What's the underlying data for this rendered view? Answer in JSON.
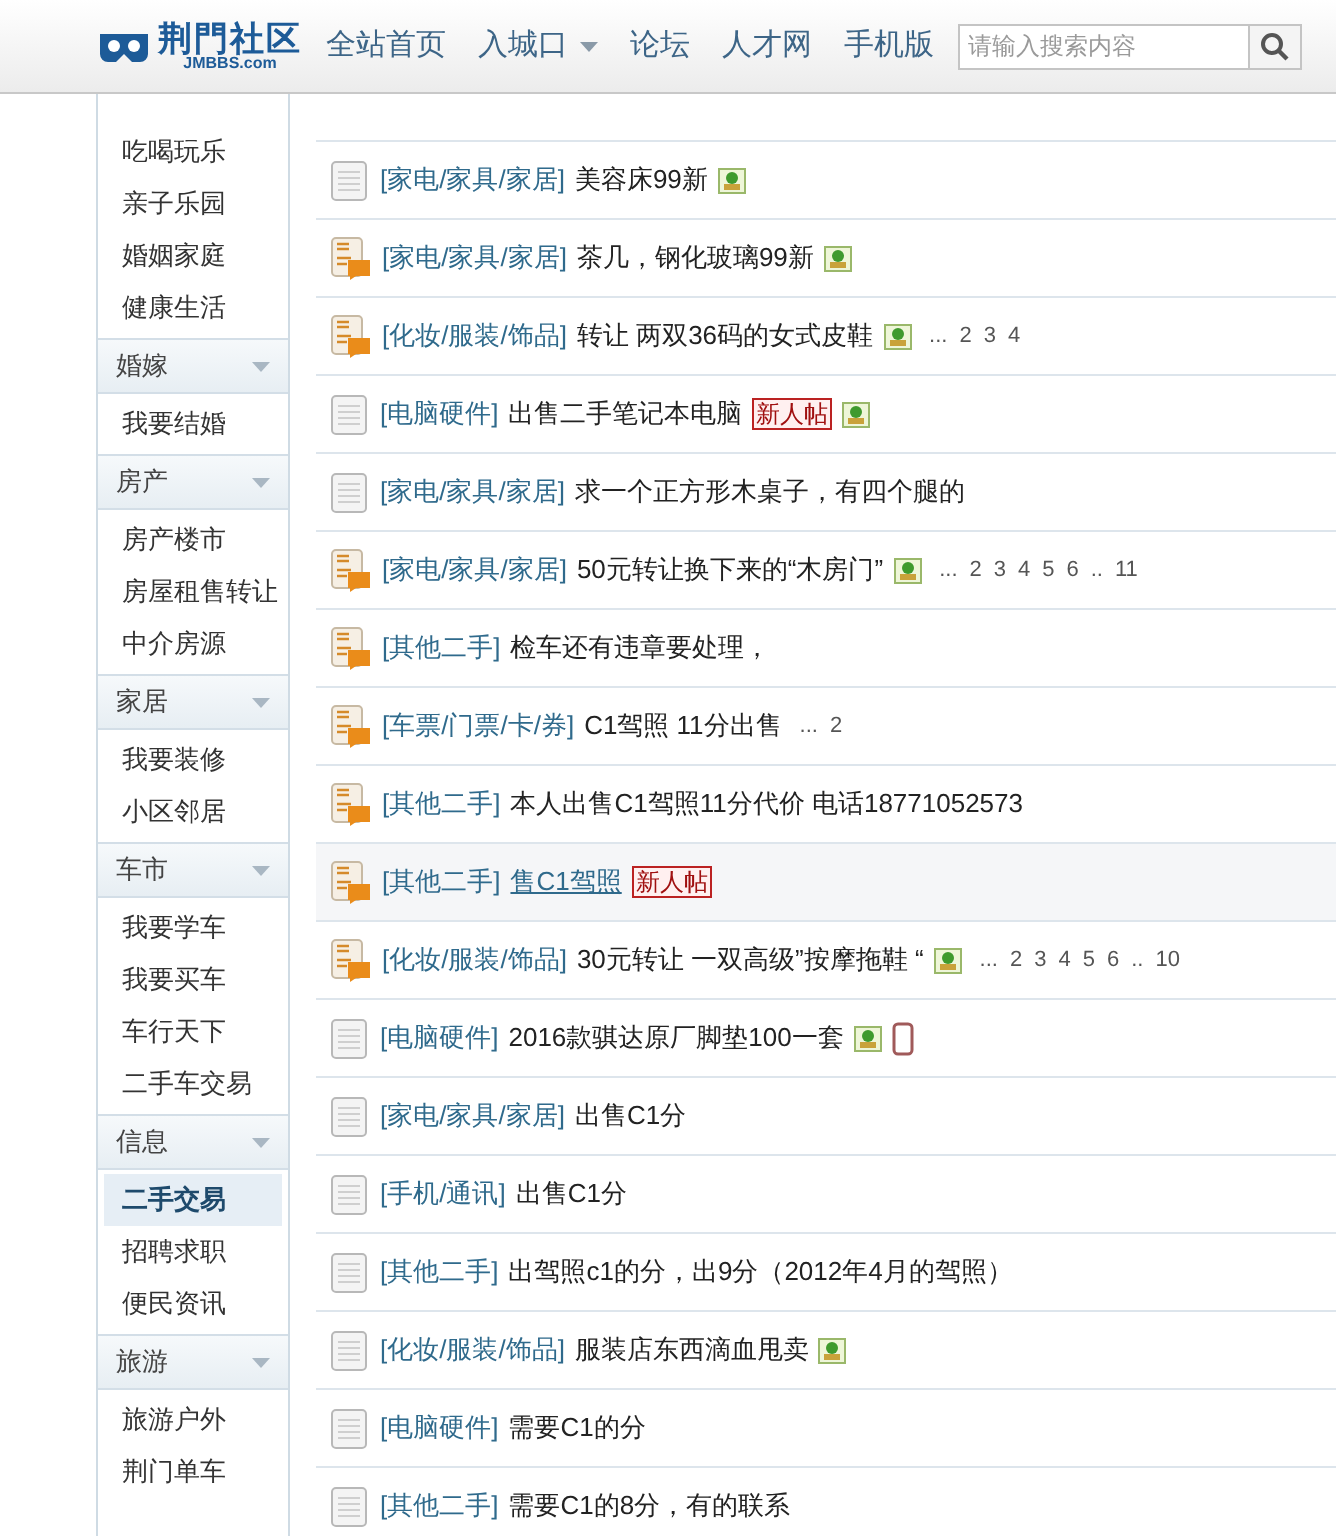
{
  "header": {
    "logo": {
      "name": "荆門社区",
      "domain": "JMBBS.com"
    },
    "nav": [
      {
        "label": "全站首页",
        "dropdown": false
      },
      {
        "label": "入城口",
        "dropdown": true
      },
      {
        "label": "论坛",
        "dropdown": false
      },
      {
        "label": "人才网",
        "dropdown": false
      },
      {
        "label": "手机版",
        "dropdown": false
      }
    ],
    "search": {
      "placeholder": "请输入搜索内容"
    }
  },
  "sidebar": [
    {
      "kind": "item",
      "label": "吃喝玩乐",
      "selected": false
    },
    {
      "kind": "item",
      "label": "亲子乐园",
      "selected": false
    },
    {
      "kind": "item",
      "label": "婚姻家庭",
      "selected": false
    },
    {
      "kind": "item",
      "label": "健康生活",
      "selected": false
    },
    {
      "kind": "group",
      "label": "婚嫁"
    },
    {
      "kind": "item",
      "label": "我要结婚",
      "selected": false
    },
    {
      "kind": "group",
      "label": "房产"
    },
    {
      "kind": "item",
      "label": "房产楼市",
      "selected": false
    },
    {
      "kind": "item",
      "label": "房屋租售转让",
      "selected": false
    },
    {
      "kind": "item",
      "label": "中介房源",
      "selected": false
    },
    {
      "kind": "group",
      "label": "家居"
    },
    {
      "kind": "item",
      "label": "我要装修",
      "selected": false
    },
    {
      "kind": "item",
      "label": "小区邻居",
      "selected": false
    },
    {
      "kind": "group",
      "label": "车市"
    },
    {
      "kind": "item",
      "label": "我要学车",
      "selected": false
    },
    {
      "kind": "item",
      "label": "我要买车",
      "selected": false
    },
    {
      "kind": "item",
      "label": "车行天下",
      "selected": false
    },
    {
      "kind": "item",
      "label": "二手车交易",
      "selected": false
    },
    {
      "kind": "group",
      "label": "信息"
    },
    {
      "kind": "item",
      "label": "二手交易",
      "selected": true
    },
    {
      "kind": "item",
      "label": "招聘求职",
      "selected": false
    },
    {
      "kind": "item",
      "label": "便民资讯",
      "selected": false
    },
    {
      "kind": "group",
      "label": "旅游"
    },
    {
      "kind": "item",
      "label": "旅游户外",
      "selected": false
    },
    {
      "kind": "item",
      "label": "荆门单车",
      "selected": false
    }
  ],
  "threads": [
    {
      "kind": "normal",
      "category": "[家电/家具/家居]",
      "title": "美容床99新",
      "hovered": false,
      "tags": [
        {
          "kind": "image"
        }
      ]
    },
    {
      "kind": "hot",
      "category": "[家电/家具/家居]",
      "title": "茶几，钢化玻璃99新",
      "hovered": false,
      "tags": [
        {
          "kind": "image"
        }
      ]
    },
    {
      "kind": "hot",
      "category": "[化妆/服装/饰品]",
      "title": "转让 两双36码的女式皮鞋",
      "hovered": false,
      "tags": [
        {
          "kind": "image"
        }
      ],
      "pages": [
        "...",
        "2",
        "3",
        "4"
      ]
    },
    {
      "kind": "normal",
      "category": "[电脑硬件]",
      "title": "出售二手笔记本电脑",
      "hovered": false,
      "tags": [
        {
          "kind": "new",
          "label": "新人帖"
        },
        {
          "kind": "image"
        }
      ]
    },
    {
      "kind": "normal",
      "category": "[家电/家具/家居]",
      "title": "求一个正方形木桌子，有四个腿的",
      "hovered": false
    },
    {
      "kind": "hot",
      "category": "[家电/家具/家居]",
      "title": "50元转让换下来的“木房门”",
      "hovered": false,
      "tags": [
        {
          "kind": "image"
        }
      ],
      "pages": [
        "...",
        "2",
        "3",
        "4",
        "5",
        "6",
        "..",
        "11"
      ]
    },
    {
      "kind": "hot",
      "category": "[其他二手]",
      "title": "检车还有违章要处理，",
      "hovered": false
    },
    {
      "kind": "hot",
      "category": "[车票/门票/卡/券]",
      "title": "C1驾照 11分出售",
      "hovered": false,
      "pages": [
        "...",
        "2"
      ]
    },
    {
      "kind": "hot",
      "category": "[其他二手]",
      "title": "本人出售C1驾照11分代价 电话18771052573",
      "hovered": false
    },
    {
      "kind": "hot",
      "category": "[其他二手]",
      "title": "售C1驾照",
      "hovered": true,
      "tags": [
        {
          "kind": "new",
          "label": "新人帖"
        }
      ]
    },
    {
      "kind": "hot",
      "category": "[化妆/服装/饰品]",
      "title": "30元转让 一双高级”按摩拖鞋 “",
      "hovered": false,
      "tags": [
        {
          "kind": "image"
        }
      ],
      "pages": [
        "...",
        "2",
        "3",
        "4",
        "5",
        "6",
        "..",
        "10"
      ]
    },
    {
      "kind": "normal",
      "category": "[电脑硬件]",
      "title": "2016款骐达原厂脚垫100一套",
      "hovered": false,
      "tags": [
        {
          "kind": "image"
        },
        {
          "kind": "mobile"
        }
      ]
    },
    {
      "kind": "normal",
      "category": "[家电/家具/家居]",
      "title": "出售C1分",
      "hovered": false
    },
    {
      "kind": "normal",
      "category": "[手机/通讯]",
      "title": "出售C1分",
      "hovered": false
    },
    {
      "kind": "normal",
      "category": "[其他二手]",
      "title": "出驾照c1的分，出9分（2012年4月的驾照）",
      "hovered": false
    },
    {
      "kind": "normal",
      "category": "[化妆/服装/饰品]",
      "title": "服装店东西滴血甩卖",
      "hovered": false,
      "tags": [
        {
          "kind": "image"
        }
      ]
    },
    {
      "kind": "normal",
      "category": "[电脑硬件]",
      "title": "需要C1的分",
      "hovered": false
    },
    {
      "kind": "normal",
      "category": "[其他二手]",
      "title": "需要C1的8分，有的联系",
      "hovered": false
    }
  ]
}
